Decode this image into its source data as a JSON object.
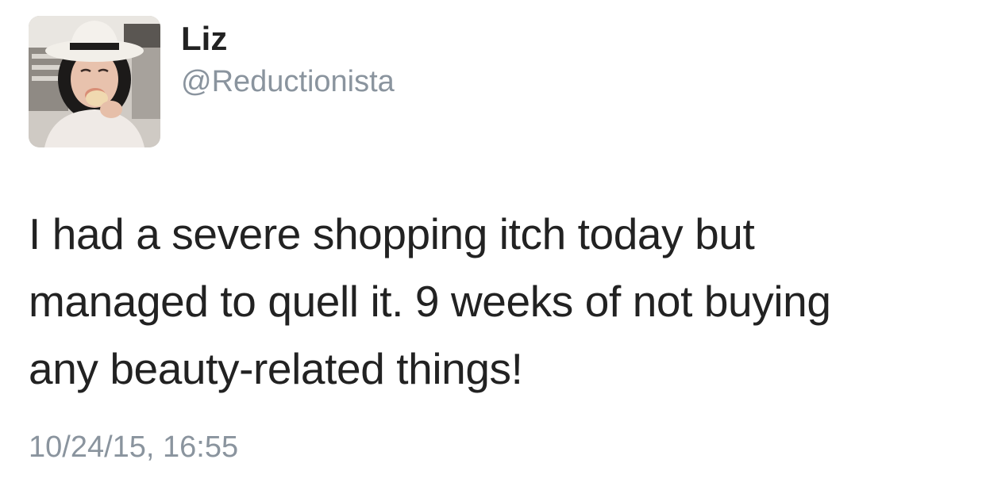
{
  "tweet": {
    "author": {
      "display_name": "Liz",
      "handle": "@Reductionista",
      "avatar_icon": "profile-photo"
    },
    "text_lines": [
      "I had a severe shopping itch today but",
      "managed to quell it. 9 weeks of not buying",
      "any beauty-related things!"
    ],
    "timestamp": "10/24/15, 16:55"
  },
  "colors": {
    "text": "#222222",
    "secondary_text": "#8a949e",
    "background": "#ffffff"
  }
}
